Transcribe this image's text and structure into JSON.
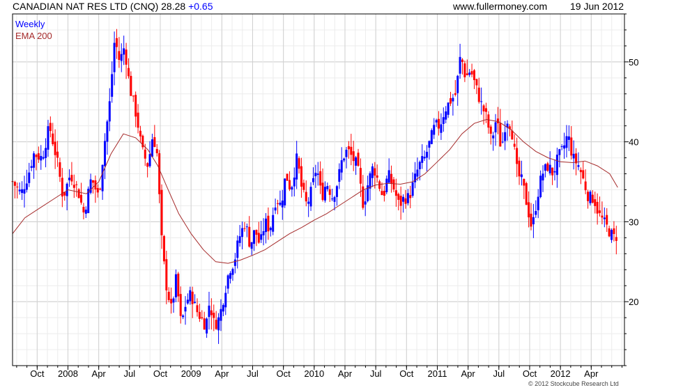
{
  "header": {
    "title": "CANADIAN NAT RES LTD (CNQ) 28.28",
    "change": "+0.65",
    "site": "www.fullermoney.com",
    "date": "19 Jun 2012"
  },
  "footer": {
    "copyright": "© 2012 Stockcube Research Ltd"
  },
  "colors": {
    "up": "#0000ff",
    "down": "#ff0000",
    "ema": "#a52a2a",
    "grid": "#cccccc",
    "frame": "#000000"
  },
  "chart_data": {
    "type": "candlestick",
    "legend": [
      {
        "label": "Weekly",
        "color": "#0000ff"
      },
      {
        "label": "EMA 200",
        "color": "#a52a2a"
      }
    ],
    "legend_position": "top-left",
    "y_axis_position": "right",
    "ylim": [
      12,
      56
    ],
    "yticks": [
      20,
      30,
      40,
      50
    ],
    "grid": true,
    "xlim": [
      2007.55,
      2012.52
    ],
    "x_ticks": [
      {
        "x": 2007.75,
        "label": "Oct"
      },
      {
        "x": 2008.0,
        "label": "2008"
      },
      {
        "x": 2008.25,
        "label": "Apr"
      },
      {
        "x": 2008.5,
        "label": "Jul"
      },
      {
        "x": 2008.75,
        "label": "Oct"
      },
      {
        "x": 2009.0,
        "label": "2009"
      },
      {
        "x": 2009.25,
        "label": "Apr"
      },
      {
        "x": 2009.5,
        "label": "Jul"
      },
      {
        "x": 2009.75,
        "label": "Oct"
      },
      {
        "x": 2010.0,
        "label": "2010"
      },
      {
        "x": 2010.25,
        "label": "Apr"
      },
      {
        "x": 2010.5,
        "label": "Jul"
      },
      {
        "x": 2010.75,
        "label": "Oct"
      },
      {
        "x": 2011.0,
        "label": "2011"
      },
      {
        "x": 2011.25,
        "label": "Apr"
      },
      {
        "x": 2011.5,
        "label": "Jul"
      },
      {
        "x": 2011.75,
        "label": "Oct"
      },
      {
        "x": 2012.0,
        "label": "2012"
      },
      {
        "x": 2012.25,
        "label": "Apr"
      }
    ],
    "close_path": [
      [
        2007.55,
        35
      ],
      [
        2007.62,
        33.5
      ],
      [
        2007.68,
        36
      ],
      [
        2007.72,
        38.5
      ],
      [
        2007.79,
        38
      ],
      [
        2007.85,
        42
      ],
      [
        2007.92,
        37
      ],
      [
        2007.96,
        33
      ],
      [
        2008.02,
        36
      ],
      [
        2008.08,
        34
      ],
      [
        2008.13,
        31
      ],
      [
        2008.19,
        35.5
      ],
      [
        2008.25,
        33
      ],
      [
        2008.29,
        39
      ],
      [
        2008.34,
        45
      ],
      [
        2008.38,
        53
      ],
      [
        2008.42,
        50
      ],
      [
        2008.46,
        52
      ],
      [
        2008.5,
        47
      ],
      [
        2008.56,
        43
      ],
      [
        2008.6,
        39
      ],
      [
        2008.65,
        37
      ],
      [
        2008.69,
        41
      ],
      [
        2008.73,
        38
      ],
      [
        2008.75,
        30
      ],
      [
        2008.77,
        26
      ],
      [
        2008.8,
        22
      ],
      [
        2008.84,
        19
      ],
      [
        2008.88,
        23
      ],
      [
        2008.92,
        17
      ],
      [
        2008.96,
        20
      ],
      [
        2009.0,
        21
      ],
      [
        2009.04,
        19
      ],
      [
        2009.08,
        18
      ],
      [
        2009.12,
        17
      ],
      [
        2009.15,
        20
      ],
      [
        2009.19,
        17
      ],
      [
        2009.23,
        18
      ],
      [
        2009.27,
        21
      ],
      [
        2009.31,
        24
      ],
      [
        2009.35,
        25
      ],
      [
        2009.39,
        28
      ],
      [
        2009.44,
        30
      ],
      [
        2009.48,
        27
      ],
      [
        2009.52,
        29
      ],
      [
        2009.56,
        27
      ],
      [
        2009.6,
        30
      ],
      [
        2009.64,
        29
      ],
      [
        2009.69,
        33
      ],
      [
        2009.73,
        32
      ],
      [
        2009.77,
        36
      ],
      [
        2009.81,
        34
      ],
      [
        2009.86,
        38
      ],
      [
        2009.9,
        34
      ],
      [
        2009.94,
        32
      ],
      [
        2009.98,
        34
      ],
      [
        2010.02,
        37
      ],
      [
        2010.06,
        33
      ],
      [
        2010.1,
        35
      ],
      [
        2010.15,
        33
      ],
      [
        2010.19,
        35
      ],
      [
        2010.23,
        38
      ],
      [
        2010.27,
        39
      ],
      [
        2010.31,
        38
      ],
      [
        2010.35,
        37
      ],
      [
        2010.4,
        32
      ],
      [
        2010.44,
        35
      ],
      [
        2010.48,
        37
      ],
      [
        2010.52,
        35
      ],
      [
        2010.56,
        33
      ],
      [
        2010.6,
        36
      ],
      [
        2010.65,
        34
      ],
      [
        2010.69,
        32
      ],
      [
        2010.73,
        33
      ],
      [
        2010.77,
        33
      ],
      [
        2010.81,
        35
      ],
      [
        2010.85,
        37
      ],
      [
        2010.9,
        38
      ],
      [
        2010.94,
        40
      ],
      [
        2010.98,
        42
      ],
      [
        2011.02,
        42
      ],
      [
        2011.06,
        44
      ],
      [
        2011.1,
        45
      ],
      [
        2011.15,
        46
      ],
      [
        2011.19,
        51
      ],
      [
        2011.23,
        48
      ],
      [
        2011.27,
        49
      ],
      [
        2011.31,
        47
      ],
      [
        2011.35,
        45
      ],
      [
        2011.4,
        43
      ],
      [
        2011.44,
        40
      ],
      [
        2011.48,
        43
      ],
      [
        2011.52,
        39
      ],
      [
        2011.56,
        43
      ],
      [
        2011.6,
        42
      ],
      [
        2011.65,
        36
      ],
      [
        2011.69,
        35
      ],
      [
        2011.73,
        32
      ],
      [
        2011.77,
        29
      ],
      [
        2011.81,
        33
      ],
      [
        2011.85,
        36
      ],
      [
        2011.9,
        37
      ],
      [
        2011.94,
        36
      ],
      [
        2011.98,
        38
      ],
      [
        2012.02,
        39
      ],
      [
        2012.06,
        41
      ],
      [
        2012.1,
        38
      ],
      [
        2012.15,
        37
      ],
      [
        2012.19,
        35
      ],
      [
        2012.23,
        33
      ],
      [
        2012.27,
        33
      ],
      [
        2012.31,
        31
      ],
      [
        2012.35,
        30
      ],
      [
        2012.39,
        29
      ],
      [
        2012.43,
        28
      ],
      [
        2012.465,
        28.28
      ]
    ],
    "ema_200": [
      [
        2007.55,
        28.5
      ],
      [
        2007.65,
        30.5
      ],
      [
        2007.75,
        31.5
      ],
      [
        2007.9,
        33
      ],
      [
        2008.0,
        34
      ],
      [
        2008.15,
        33.5
      ],
      [
        2008.25,
        35
      ],
      [
        2008.35,
        38.5
      ],
      [
        2008.45,
        41
      ],
      [
        2008.55,
        40.5
      ],
      [
        2008.65,
        39
      ],
      [
        2008.73,
        37
      ],
      [
        2008.8,
        34.5
      ],
      [
        2008.9,
        31
      ],
      [
        2009.0,
        28.5
      ],
      [
        2009.1,
        26.5
      ],
      [
        2009.2,
        25
      ],
      [
        2009.3,
        24.8
      ],
      [
        2009.4,
        25.2
      ],
      [
        2009.5,
        25.8
      ],
      [
        2009.6,
        26.5
      ],
      [
        2009.7,
        27.5
      ],
      [
        2009.8,
        28.5
      ],
      [
        2009.9,
        29.3
      ],
      [
        2010.0,
        30.2
      ],
      [
        2010.1,
        31
      ],
      [
        2010.2,
        32
      ],
      [
        2010.3,
        33
      ],
      [
        2010.4,
        34
      ],
      [
        2010.5,
        34.6
      ],
      [
        2010.6,
        34.8
      ],
      [
        2010.7,
        34.7
      ],
      [
        2010.8,
        35
      ],
      [
        2010.9,
        36
      ],
      [
        2011.0,
        37.5
      ],
      [
        2011.1,
        39
      ],
      [
        2011.2,
        41
      ],
      [
        2011.3,
        42.3
      ],
      [
        2011.4,
        42.8
      ],
      [
        2011.5,
        42.5
      ],
      [
        2011.6,
        41.5
      ],
      [
        2011.7,
        40
      ],
      [
        2011.8,
        38.8
      ],
      [
        2011.9,
        38
      ],
      [
        2012.0,
        37.5
      ],
      [
        2012.1,
        37.4
      ],
      [
        2012.2,
        37.6
      ],
      [
        2012.3,
        37
      ],
      [
        2012.4,
        36
      ],
      [
        2012.465,
        34.3
      ]
    ]
  }
}
